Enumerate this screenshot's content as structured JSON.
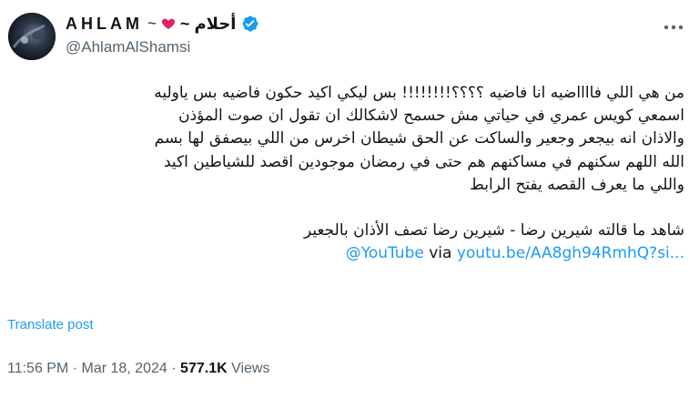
{
  "tweet": {
    "display_name_latin": "AHLAM",
    "tilde": "~",
    "display_name_arabic": "أحلام ~",
    "handle": "@AhlamAlShamsi",
    "heart_icon": "red-heart-icon",
    "verified_icon": "verified-badge-icon",
    "more_icon": "more-options-icon",
    "body_lines": [
      "من هي اللي فااااضيه انا فاضيه ؟؟؟؟!!!!!!!! بس ليكي اكيد حكون فاضيه بس ياوليه",
      "اسمعي كويس عمري في حياتي مش حسمح لاشكالك ان تقول ان صوت المؤذن",
      "والاذان انه بيجعر وجعير والساكت عن الحق شيطان اخرس من اللي بيصفق لها بسم",
      "الله اللهم سكنهم في مساكنهم هم حتى في رمضان موجودين اقصد للشياطين اكيد",
      "واللي ما يعرف القصه يفتح الرابط"
    ],
    "share_line": "شاهد ما قالته شيرين رضا - شيرين رضا تصف الأذان بالجعير",
    "mention": "@YouTube",
    "via": "via",
    "link": "youtu.be/AA8gh94RmhQ?si...",
    "translate_label": "Translate post",
    "time": "11:56 PM",
    "separator": "·",
    "date": "Mar 18, 2024",
    "views_count": "577.1K",
    "views_label": "Views"
  },
  "colors": {
    "accent": "#1d9bf0",
    "text": "#0f1419",
    "secondary": "#536471",
    "heart": "#f91880"
  }
}
